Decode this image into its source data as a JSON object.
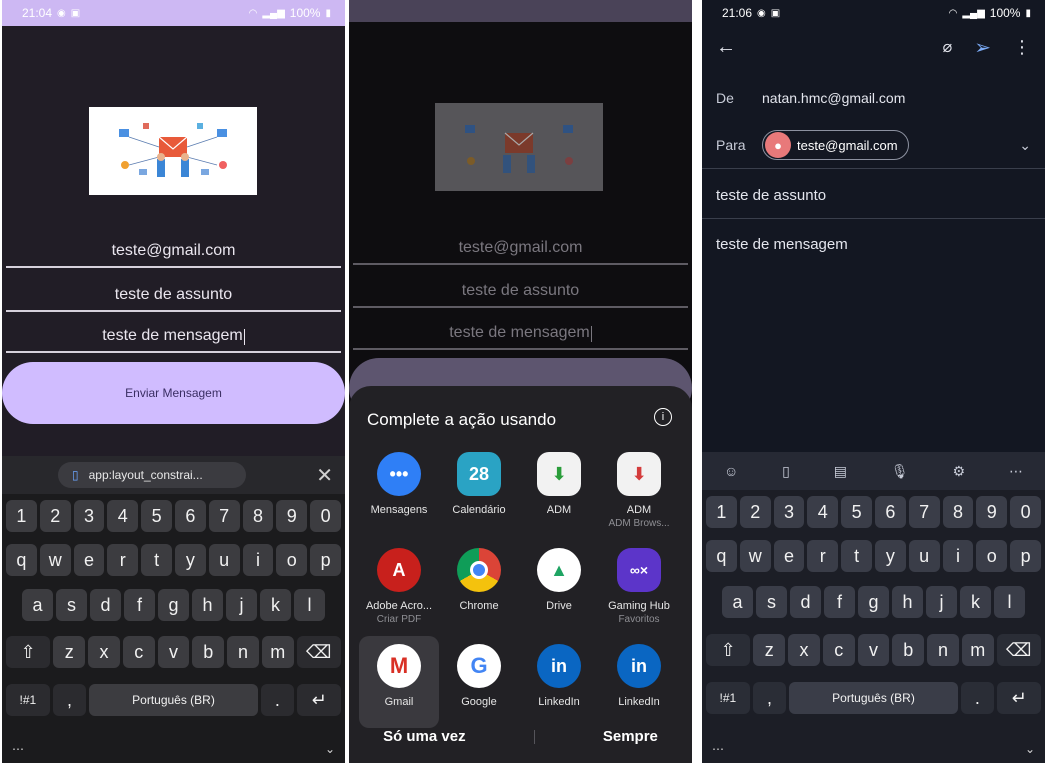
{
  "panel1": {
    "status": {
      "time": "21:04",
      "battery": "100%"
    },
    "fields": {
      "email": "teste@gmail.com",
      "subject": "teste de assunto",
      "message": "teste de mensagem"
    },
    "send_label": "Enviar Mensagem",
    "clipboard_suggestion": "app:layout_constrai...",
    "keyboard": {
      "row_numbers": [
        "1",
        "2",
        "3",
        "4",
        "5",
        "6",
        "7",
        "8",
        "9",
        "0"
      ],
      "row1": [
        "q",
        "w",
        "e",
        "r",
        "t",
        "y",
        "u",
        "i",
        "o",
        "p"
      ],
      "row2": [
        "a",
        "s",
        "d",
        "f",
        "g",
        "h",
        "j",
        "k",
        "l"
      ],
      "row3": [
        "z",
        "x",
        "c",
        "v",
        "b",
        "n",
        "m"
      ],
      "symbols_label": "!#1",
      "comma": ",",
      "space_label": "Português (BR)",
      "period": "."
    }
  },
  "panel2": {
    "fields": {
      "email": "teste@gmail.com",
      "subject": "teste de assunto",
      "message": "teste de mensagem"
    },
    "sheet_title": "Complete a ação usando",
    "apps": [
      {
        "label": "Mensagens",
        "sub": "",
        "icon": "messages-icon",
        "color": "#2f7ff6"
      },
      {
        "label": "Calendário",
        "sub": "",
        "icon": "calendar-icon",
        "color": "#2aa3c4",
        "text": "28"
      },
      {
        "label": "ADM",
        "sub": "",
        "icon": "download-manager-icon",
        "color": "#f2f2f2"
      },
      {
        "label": "ADM",
        "sub": "ADM Brows...",
        "icon": "download-manager-icon",
        "color": "#f2f2f2"
      },
      {
        "label": "Adobe Acro...",
        "sub": "Criar PDF",
        "icon": "adobe-acrobat-icon",
        "color": "#c8201c"
      },
      {
        "label": "Chrome",
        "sub": "",
        "icon": "chrome-icon",
        "color": "#ffffff"
      },
      {
        "label": "Drive",
        "sub": "",
        "icon": "drive-icon",
        "color": "#ffffff"
      },
      {
        "label": "Gaming Hub",
        "sub": "Favoritos",
        "icon": "gaming-hub-icon",
        "color": "#5c35c9"
      },
      {
        "label": "Gmail",
        "sub": "",
        "icon": "gmail-icon",
        "color": "#ffffff"
      },
      {
        "label": "Google",
        "sub": "",
        "icon": "google-icon",
        "color": "#ffffff"
      },
      {
        "label": "LinkedIn",
        "sub": "",
        "icon": "linkedin-icon",
        "color": "#0a66c2",
        "text": "in"
      },
      {
        "label": "LinkedIn",
        "sub": "",
        "icon": "linkedin-icon",
        "color": "#0a66c2",
        "text": "in"
      }
    ],
    "actions": {
      "once": "Só uma vez",
      "always": "Sempre"
    }
  },
  "panel3": {
    "status": {
      "time": "21:06",
      "battery": "100%"
    },
    "from_label": "De",
    "from_value": "natan.hmc@gmail.com",
    "to_label": "Para",
    "to_value": "teste@gmail.com",
    "subject": "teste de assunto",
    "body": "teste de mensagem",
    "keyboard": {
      "row_numbers": [
        "1",
        "2",
        "3",
        "4",
        "5",
        "6",
        "7",
        "8",
        "9",
        "0"
      ],
      "row1": [
        "q",
        "w",
        "e",
        "r",
        "t",
        "y",
        "u",
        "i",
        "o",
        "p"
      ],
      "row2": [
        "a",
        "s",
        "d",
        "f",
        "g",
        "h",
        "j",
        "k",
        "l"
      ],
      "row3": [
        "z",
        "x",
        "c",
        "v",
        "b",
        "n",
        "m"
      ],
      "symbols_label": "!#1",
      "comma": ",",
      "space_label": "Português (BR)",
      "period": "."
    }
  }
}
